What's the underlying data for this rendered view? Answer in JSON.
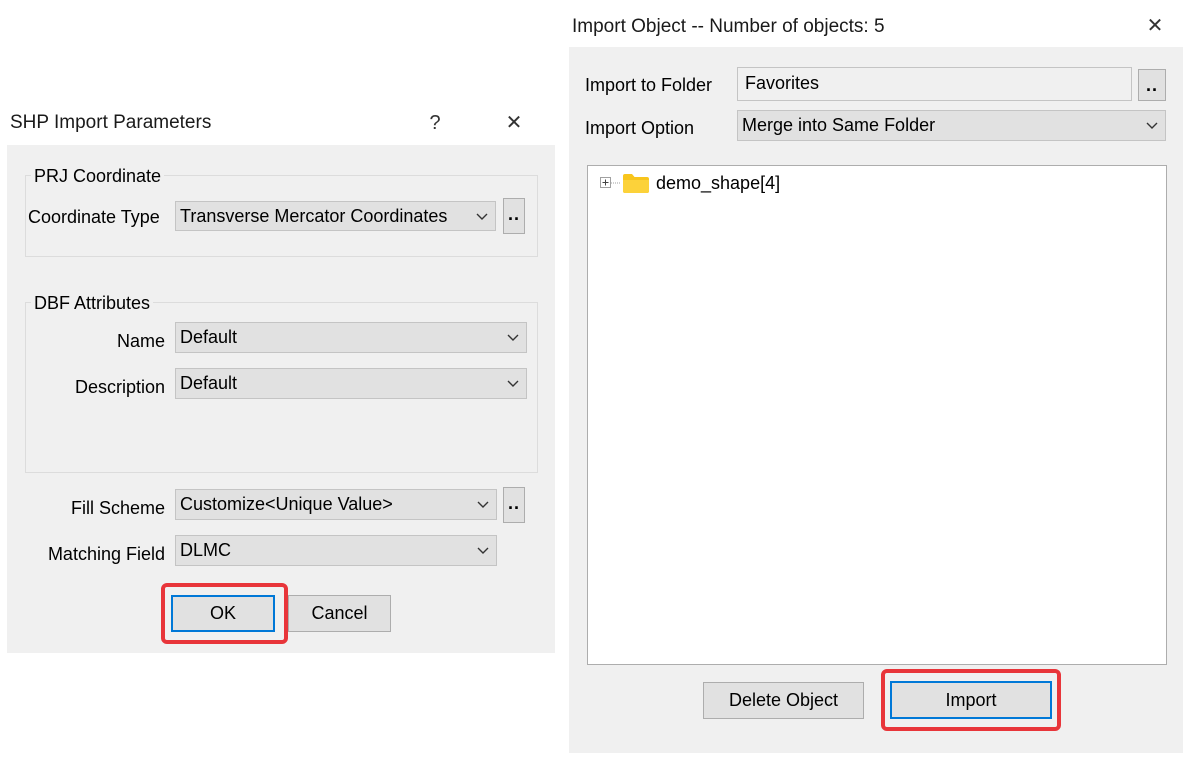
{
  "shp_dialog": {
    "title": "SHP Import Parameters",
    "help_glyph": "?",
    "close_glyph": "✕",
    "prj_group": {
      "title": "PRJ Coordinate",
      "coordinate_type_label": "Coordinate Type",
      "coordinate_type_value": "Transverse Mercator Coordinates",
      "browse_label": ".."
    },
    "dbf_group": {
      "title": "DBF Attributes",
      "name_label": "Name",
      "name_value": "Default",
      "description_label": "Description",
      "description_value": "Default"
    },
    "fill_scheme_label": "Fill Scheme",
    "fill_scheme_value": "Customize<Unique Value>",
    "fill_browse_label": "..",
    "matching_field_label": "Matching Field",
    "matching_field_value": "DLMC",
    "ok_label": "OK",
    "cancel_label": "Cancel"
  },
  "import_dialog": {
    "title": "Import Object -- Number of objects: 5",
    "close_glyph": "✕",
    "folder_label": "Import to Folder",
    "folder_value": "Favorites",
    "folder_browse_label": "..",
    "option_label": "Import Option",
    "option_value": "Merge into Same Folder",
    "tree_items": [
      {
        "label": "demo_shape[4]",
        "icon": "folder-icon",
        "expanded": false
      }
    ],
    "delete_label": "Delete Object",
    "import_label": "Import"
  },
  "colors": {
    "dialog_bg": "#f0f0f0",
    "focus_blue": "#0078d7",
    "highlight_red": "#e8353a",
    "folder_yellow": "#f8c51c"
  }
}
